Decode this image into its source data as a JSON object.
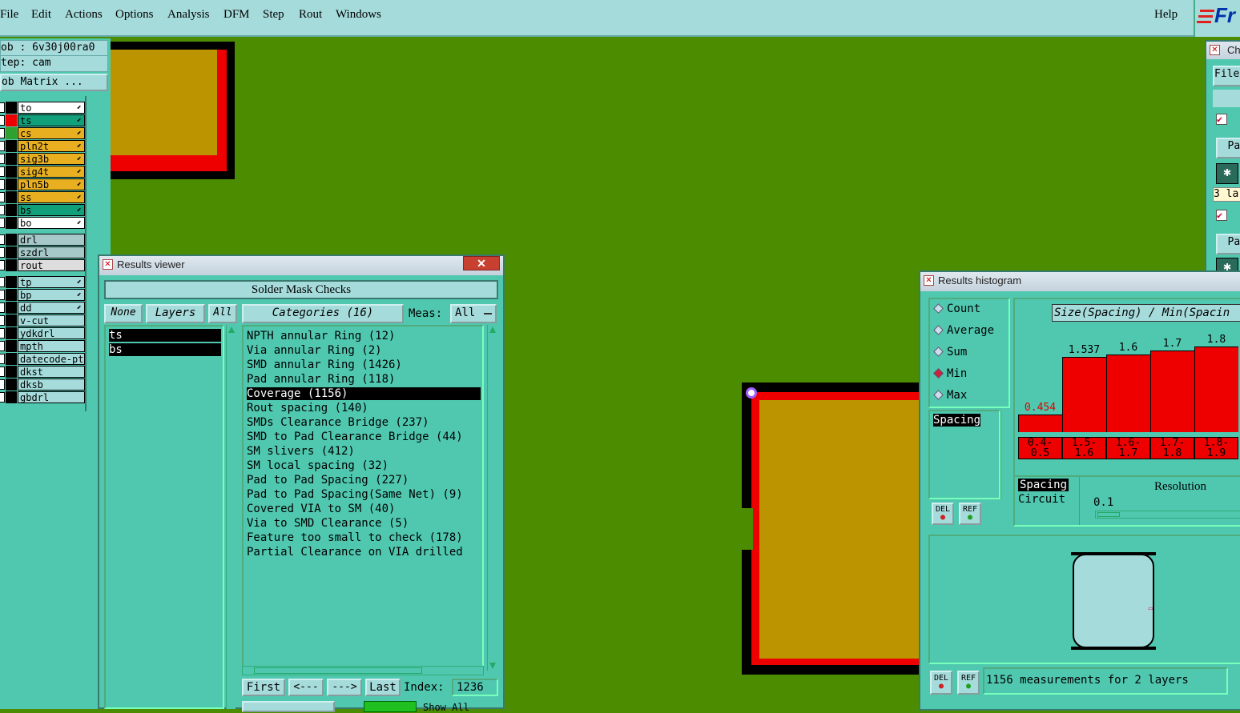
{
  "menu": {
    "items": [
      "File",
      "Edit",
      "Actions",
      "Options",
      "Analysis",
      "DFM",
      "Step",
      "Rout",
      "Windows"
    ],
    "help": "Help",
    "logo": "Fr"
  },
  "job": {
    "job_label": "ob : 6v30j00ra0",
    "step_label": "tep: cam",
    "matrix_button": "ob Matrix ..."
  },
  "layers": [
    {
      "name": "to",
      "color": "#ffffff",
      "swatch": "#000000"
    },
    {
      "name": "ts",
      "color": "#12a07a",
      "swatch": "#ee0000"
    },
    {
      "name": "cs",
      "color": "#e8b020",
      "swatch": "#30a030"
    },
    {
      "name": "pln2t",
      "color": "#e8b020",
      "swatch": "#000000"
    },
    {
      "name": "sig3b",
      "color": "#e8b020",
      "swatch": "#000000"
    },
    {
      "name": "sig4t",
      "color": "#e8b020",
      "swatch": "#000000"
    },
    {
      "name": "pln5b",
      "color": "#e8b020",
      "swatch": "#000000"
    },
    {
      "name": "ss",
      "color": "#e8b020",
      "swatch": "#000000"
    },
    {
      "name": "bs",
      "color": "#12a07a",
      "swatch": "#000000"
    },
    {
      "name": "bo",
      "color": "#ffffff",
      "swatch": "#000000"
    },
    {
      "name": "drl",
      "color": "#a6c8c8",
      "swatch": "#000000"
    },
    {
      "name": "szdrl",
      "color": "#a6c8c8",
      "swatch": "#000000"
    },
    {
      "name": "rout",
      "color": "#dddddd",
      "swatch": "#000000"
    },
    {
      "name": "tp",
      "color": "#a6dbdb",
      "swatch": "#000000"
    },
    {
      "name": "bp",
      "color": "#a6dbdb",
      "swatch": "#000000"
    },
    {
      "name": "dd",
      "color": "#a6dbdb",
      "swatch": "#000000"
    },
    {
      "name": "v-cut",
      "color": "#a6dbdb",
      "swatch": "#000000"
    },
    {
      "name": "ydkdrl",
      "color": "#a6dbdb",
      "swatch": "#000000"
    },
    {
      "name": "mpth",
      "color": "#a6dbdb",
      "swatch": "#000000"
    },
    {
      "name": "datecode-pte",
      "color": "#a6dbdb",
      "swatch": "#000000"
    },
    {
      "name": "dkst",
      "color": "#a6dbdb",
      "swatch": "#000000"
    },
    {
      "name": "dksb",
      "color": "#a6dbdb",
      "swatch": "#000000"
    },
    {
      "name": "gbdrl",
      "color": "#a6dbdb",
      "swatch": "#000000"
    }
  ],
  "results_viewer": {
    "title": "Results viewer",
    "close": "✕",
    "header": "Solder Mask Checks",
    "none_btn": "None",
    "layers_btn": "Layers",
    "all_btn": "All",
    "categories_btn": "Categories (16)",
    "meas_label": "Meas:",
    "meas_value": "All",
    "layer_items": [
      "ts",
      "bs"
    ],
    "categories": [
      "NPTH annular Ring (12)",
      "Via annular Ring (2)",
      "SMD annular Ring (1426)",
      "Pad annular Ring (118)",
      "Coverage (1156)",
      "Rout spacing (140)",
      "SMDs Clearance Bridge (237)",
      "SMD to Pad Clearance Bridge (44)",
      "SM slivers (412)",
      "SM local spacing (32)",
      "Pad to Pad Spacing (227)",
      "Pad to Pad Spacing(Same Net) (9)",
      "Covered VIA to SM (40)",
      "Via to SMD Clearance (5)",
      "Feature too small to check (178)",
      "Partial Clearance on VIA drilled"
    ],
    "selected_category": 4,
    "first_btn": "First",
    "prev_btn": "<---",
    "next_btn": "--->",
    "last_btn": "Last",
    "index_label": "Index:",
    "index_value": "1236",
    "show_all": "Show All"
  },
  "histogram": {
    "title": "Results histogram",
    "modes": [
      "Count",
      "Average",
      "Sum",
      "Min",
      "Max"
    ],
    "selected_mode": "Min",
    "chart_title": "Size(Spacing) / Min(Spacin",
    "list_item": "Spacing",
    "del_btn": "DEL",
    "ref_btn": "REF",
    "spacing_opt": "Spacing",
    "circuit_opt": "Circuit",
    "resolution_label": "Resolution",
    "resolution_value": "0.1",
    "status": "1156 measurements for 2 layers"
  },
  "chart_data": {
    "type": "bar",
    "title": "Size(Spacing) / Min(Spacin",
    "categories": [
      "0.4-0.5",
      "1.5-1.6",
      "1.6-1.7",
      "1.7-1.8",
      "1.8-1.9"
    ],
    "values": [
      0.454,
      1.537,
      1.6,
      1.7,
      1.8
    ],
    "value_labels": [
      "0.454",
      "1.537",
      "1.6",
      "1.7",
      "1.8"
    ],
    "ylim": [
      0,
      1.9
    ]
  },
  "right_window": {
    "title": "Ch",
    "file_btn": "File",
    "par1": "Par",
    "par2": "Par",
    "field": "3 la"
  }
}
